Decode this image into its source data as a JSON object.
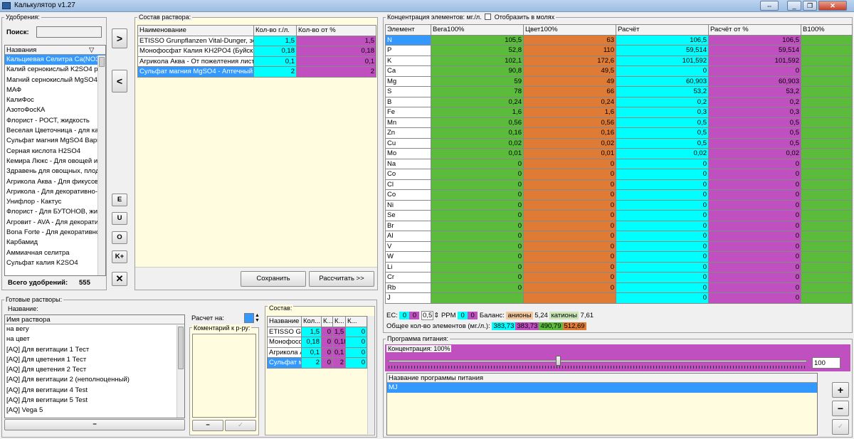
{
  "window": {
    "title": "Калькулятор v1.27"
  },
  "colors": {
    "cyan": "#00ffff",
    "purple": "#c050c0",
    "green": "#5bbc3c",
    "orange": "#e07b35",
    "cream": "#fffce0",
    "selection": "#3399ff"
  },
  "fertilizers": {
    "group_label": "Удобрения:",
    "search_label": "Поиск:",
    "search_value": "",
    "list_header": "Названия",
    "items": [
      "Кальциевая Селитра Ca(NO3)",
      "Калий сернокислый K2SO4 р",
      "Магний сернокислый MgSO4",
      "МАФ",
      "КалиФос",
      "АзотоФосКА",
      "Флорист - РОСТ, жидкость",
      "Веселая Цветочница - для ка",
      "Сульфат магния MgSO4 Вари",
      "Серная кислота H2SO4",
      "Кемира Люкс - Для овощей и",
      "Здравень для овощных, плод",
      "Агрикола Аква - Для фикусов",
      "Агрикола - Для декоративно-",
      "Унифлор - Кактус",
      "Флорист - Для БУТОНОВ, жи",
      "Агровит - AVA - Для декорати",
      "Bona Forte - Для декоративно",
      "Карбамид",
      "Аммиачная селитра",
      "Сульфат калия K2SO4"
    ],
    "total_label": "Всего удобрений:",
    "total_value": "555"
  },
  "mid_buttons": {
    "add": ">",
    "remove": "<",
    "e": "E",
    "u": "U",
    "o": "O",
    "kplus": "K+",
    "clear": "✕"
  },
  "solution": {
    "group_label": "Состав раствора:",
    "columns": [
      "Наименование",
      "Кол-во г./л.",
      "Кол-во от %"
    ],
    "rows": [
      {
        "name": "ETISSO Grunpflanzen Vital-Dunger, зеле",
        "amount": "1,5",
        "pct": "1,5"
      },
      {
        "name": "Монофосфат Калия KH2PO4 (Буйские",
        "amount": "0,18",
        "pct": "0,18"
      },
      {
        "name": "Агрикола Аква - От пожелтения листь",
        "amount": "0,1",
        "pct": "0,1"
      },
      {
        "name": "Сульфат магния MgSO4 - Аптечный 25",
        "amount": "2",
        "pct": "2"
      }
    ],
    "save_label": "Сохранить",
    "calc_label": "Рассчитать >>"
  },
  "concentration": {
    "group_label": "Концентрация элементов: мг./л.",
    "moles_label": "Отобразить в молях",
    "columns": [
      "Элемент",
      "Вега100%",
      "Цвет100%",
      "Расчёт",
      "Расчёт от %",
      "В100%"
    ],
    "rows": [
      {
        "el": "N",
        "v": "105,5",
        "c": "63",
        "r": "106,5",
        "rp": "106,5"
      },
      {
        "el": "P",
        "v": "52,8",
        "c": "110",
        "r": "59,514",
        "rp": "59,514"
      },
      {
        "el": "K",
        "v": "102,1",
        "c": "172,6",
        "r": "101,592",
        "rp": "101,592"
      },
      {
        "el": "Ca",
        "v": "90,8",
        "c": "49,5",
        "r": "0",
        "rp": "0"
      },
      {
        "el": "Mg",
        "v": "59",
        "c": "49",
        "r": "60,903",
        "rp": "60,903"
      },
      {
        "el": "S",
        "v": "78",
        "c": "66",
        "r": "53,2",
        "rp": "53,2"
      },
      {
        "el": "B",
        "v": "0,24",
        "c": "0,24",
        "r": "0,2",
        "rp": "0,2"
      },
      {
        "el": "Fe",
        "v": "1,6",
        "c": "1,6",
        "r": "0,3",
        "rp": "0,3"
      },
      {
        "el": "Mn",
        "v": "0,56",
        "c": "0,56",
        "r": "0,5",
        "rp": "0,5"
      },
      {
        "el": "Zn",
        "v": "0,16",
        "c": "0,16",
        "r": "0,5",
        "rp": "0,5"
      },
      {
        "el": "Cu",
        "v": "0,02",
        "c": "0,02",
        "r": "0,5",
        "rp": "0,5"
      },
      {
        "el": "Mo",
        "v": "0,01",
        "c": "0,01",
        "r": "0,02",
        "rp": "0,02"
      },
      {
        "el": "Na",
        "v": "0",
        "c": "0",
        "r": "0",
        "rp": "0"
      },
      {
        "el": "Co",
        "v": "0",
        "c": "0",
        "r": "0",
        "rp": "0"
      },
      {
        "el": "Cl",
        "v": "0",
        "c": "0",
        "r": "0",
        "rp": "0"
      },
      {
        "el": "Co",
        "v": "0",
        "c": "0",
        "r": "0",
        "rp": "0"
      },
      {
        "el": "Ni",
        "v": "0",
        "c": "0",
        "r": "0",
        "rp": "0"
      },
      {
        "el": "Se",
        "v": "0",
        "c": "0",
        "r": "0",
        "rp": "0"
      },
      {
        "el": "Br",
        "v": "0",
        "c": "0",
        "r": "0",
        "rp": "0"
      },
      {
        "el": "Al",
        "v": "0",
        "c": "0",
        "r": "0",
        "rp": "0"
      },
      {
        "el": "V",
        "v": "0",
        "c": "0",
        "r": "0",
        "rp": "0"
      },
      {
        "el": "W",
        "v": "0",
        "c": "0",
        "r": "0",
        "rp": "0"
      },
      {
        "el": "Li",
        "v": "0",
        "c": "0",
        "r": "0",
        "rp": "0"
      },
      {
        "el": "Cr",
        "v": "0",
        "c": "0",
        "r": "0",
        "rp": "0"
      },
      {
        "el": "Rb",
        "v": "0",
        "c": "0",
        "r": "0",
        "rp": "0"
      },
      {
        "el": "J",
        "v": "",
        "c": "",
        "r": "0",
        "rp": "0"
      }
    ],
    "ec_label": "EC:",
    "ec_v1": "0",
    "ec_v2": "0",
    "ec_step": "0,5",
    "ppm_label": "PPM",
    "ppm_v1": "0",
    "ppm_v2": "0",
    "balance_label": "Баланс:",
    "anions_label": "анионы",
    "anions_value": "5,24",
    "cations_label": "катионы",
    "cations_value": "7,61",
    "total_label": "Общее кол-во элементов (мг./л.):",
    "totals": [
      "383,73",
      "383,73",
      "490,79",
      "512,69"
    ]
  },
  "ready": {
    "group_label": "Готовые растворы:",
    "name_label": "Название:",
    "list_header": "Имя раствора",
    "items": [
      "на вегу",
      "на цвет",
      "[AQ] Для вегитации 1 Тест",
      "[AQ] Для цветения 1 Тест",
      "[AQ] Для цветения 2 Тест",
      "[AQ] Для вегитации 2 (неполноценный)",
      "[AQ] Для вегитации 4 Test",
      "[AQ] Для вегитации 5 Test",
      "[AQ] Vega 5"
    ],
    "minus_label": "−",
    "calc_on_label": "Расчет на:",
    "calc_on_value": "",
    "comment_label": "Коментарий к р-ру:",
    "comment_minus": "−",
    "comment_check": "✓"
  },
  "composition": {
    "group_label": "Состав:",
    "columns": [
      "Название",
      "Кол...",
      "К...",
      "К...",
      "К..."
    ],
    "rows": [
      {
        "name": "ETISSO Gr",
        "a": "1,5",
        "b": "0",
        "c": "1,5",
        "d": "0"
      },
      {
        "name": "Монофосф",
        "a": "0,18",
        "b": "0",
        "c": "0,18",
        "d": "0"
      },
      {
        "name": "Агрикола А",
        "a": "0,1",
        "b": "0",
        "c": "0,1",
        "d": "0"
      },
      {
        "name": "Сульфат м",
        "a": "2",
        "b": "0",
        "c": "2",
        "d": "0"
      }
    ]
  },
  "program": {
    "group_label": "Программа питания:",
    "conc_label": "Концентрация: 100%",
    "slider_value": "100",
    "slider_fraction": 0.4,
    "list_header": "Название программы питания",
    "items": [
      "MJ"
    ],
    "plus_label": "+",
    "minus_label": "−",
    "check_label": "✓"
  }
}
